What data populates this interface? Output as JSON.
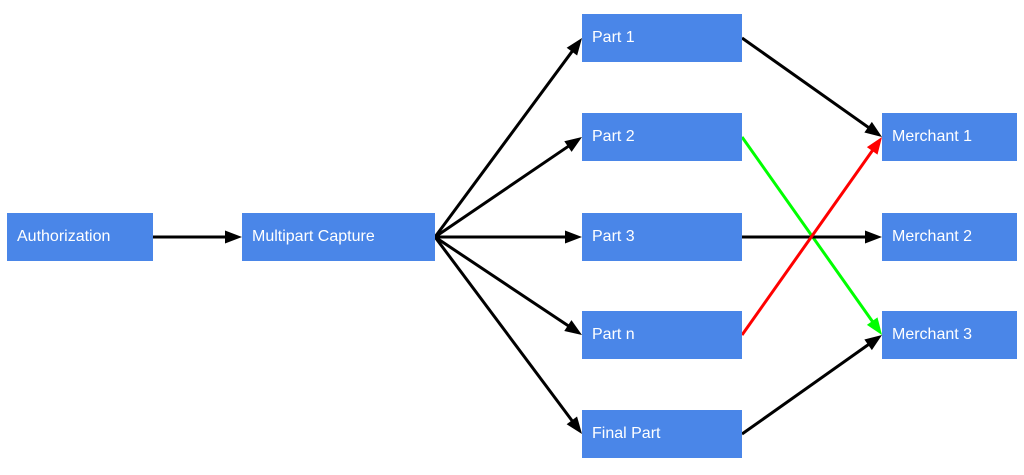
{
  "colors": {
    "node_fill": "#4a86e8",
    "node_text": "#ffffff",
    "edge_default": "#000000",
    "edge_red": "#ff0000",
    "edge_green": "#00ff00"
  },
  "nodes": {
    "authorization": "Authorization",
    "multipart_capture": "Multipart Capture",
    "part_1": "Part 1",
    "part_2": "Part 2",
    "part_3": "Part 3",
    "part_n": "Part n",
    "final_part": "Final Part",
    "merchant_1": "Merchant 1",
    "merchant_2": "Merchant 2",
    "merchant_3": "Merchant 3"
  },
  "edges": [
    {
      "from": "authorization",
      "to": "multipart_capture",
      "color": "edge_default"
    },
    {
      "from": "multipart_capture",
      "to": "part_1",
      "color": "edge_default"
    },
    {
      "from": "multipart_capture",
      "to": "part_2",
      "color": "edge_default"
    },
    {
      "from": "multipart_capture",
      "to": "part_3",
      "color": "edge_default"
    },
    {
      "from": "multipart_capture",
      "to": "part_n",
      "color": "edge_default"
    },
    {
      "from": "multipart_capture",
      "to": "final_part",
      "color": "edge_default"
    },
    {
      "from": "part_1",
      "to": "merchant_1",
      "color": "edge_default"
    },
    {
      "from": "part_2",
      "to": "merchant_3",
      "color": "edge_green"
    },
    {
      "from": "part_3",
      "to": "merchant_2",
      "color": "edge_default"
    },
    {
      "from": "part_n",
      "to": "merchant_1",
      "color": "edge_red"
    },
    {
      "from": "final_part",
      "to": "merchant_3",
      "color": "edge_default"
    }
  ]
}
